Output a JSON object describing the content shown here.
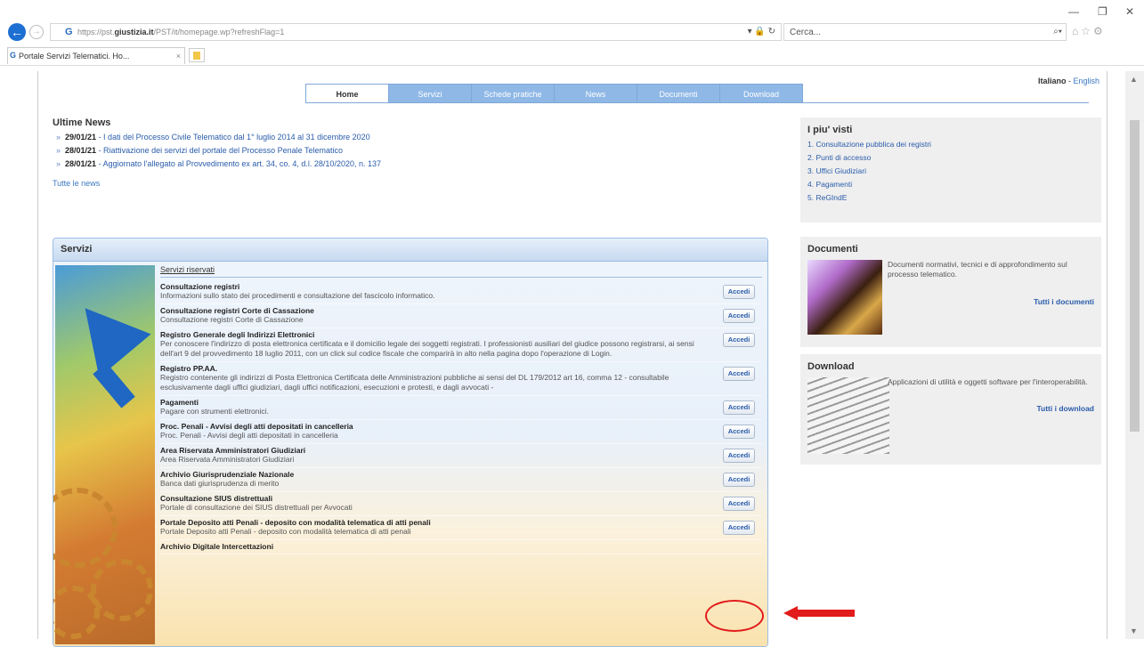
{
  "browser": {
    "url_prefix": "https://pst.",
    "url_domain": "giustizia.it",
    "url_path": "/PST/it/homepage.wp?refreshFlag=1",
    "address_controls": "▾ 🔒 ↻",
    "search_placeholder": "Cerca...",
    "search_icon": "⌕▾",
    "tab_title": "Portale Servizi Telematici. Ho...",
    "tab_close": "×",
    "back_icon": "←",
    "forward_icon": "→",
    "toolbar_icons": "⌂☆⚙",
    "minimize": "—",
    "maximize": "❐",
    "close": "✕",
    "scroll_up": "▲",
    "scroll_down": "▼"
  },
  "header": {
    "lang_current": "Italiano",
    "lang_sep": " - ",
    "lang_other": "English"
  },
  "nav": {
    "tabs": [
      "Home",
      "Servizi",
      "Schede pratiche",
      "News",
      "Documenti",
      "Download"
    ]
  },
  "news": {
    "title": "Ultime News",
    "items": [
      {
        "date": "29/01/21",
        "text": " - I dati del Processo Civile Telematico dal 1° luglio 2014 al 31 dicembre 2020"
      },
      {
        "date": "28/01/21",
        "text": " - Riattivazione dei servizi del portale del Processo Penale Telematico"
      },
      {
        "date": "28/01/21",
        "text": " - Aggiornato l'allegato al Provvedimento ex art. 34, co. 4, d.l. 28/10/2020, n. 137"
      }
    ],
    "all_link": "Tutte le news",
    "bullet": "»"
  },
  "servizi": {
    "title": "Servizi",
    "subtitle": "Servizi riservati",
    "button_label": "Accedi",
    "items": [
      {
        "name": "Consultazione registri",
        "desc": "Informazioni sullo stato dei procedimenti e consultazione del fascicolo informatico."
      },
      {
        "name": "Consultazione registri Corte di Cassazione",
        "desc": "Consultazione registri Corte di Cassazione"
      },
      {
        "name": "Registro Generale degli Indirizzi Elettronici",
        "desc": "Per conoscere l'indirizzo di posta elettronica certificata e il domicilio legale dei soggetti registrati. I professionisti ausiliari del giudice possono registrarsi, ai sensi dell'art 9 del provvedimento 18 luglio 2011, con un click sul codice fiscale che comparirà in alto nella pagina dopo l'operazione di Login."
      },
      {
        "name": "Registro PP.AA.",
        "desc": "Registro contenente gli indirizzi di Posta Elettronica Certificata delle Amministrazioni pubbliche ai sensi del DL 179/2012 art 16, comma 12 - consultabile esclusivamente dagli uffici giudiziari, dagli uffici notificazioni, esecuzioni e protesti, e dagli avvocati -"
      },
      {
        "name": "Pagamenti",
        "desc": "Pagare con strumenti elettronici."
      },
      {
        "name": "Proc. Penali - Avvisi degli atti depositati in cancelleria",
        "desc": "Proc. Penali - Avvisi degli atti depositati in cancelleria"
      },
      {
        "name": "Area Riservata Amministratori Giudiziari",
        "desc": "Area Riservata Amministratori Giudiziari"
      },
      {
        "name": "Archivio Giurisprudenziale Nazionale",
        "desc": "Banca dati giurisprudenza di merito"
      },
      {
        "name": "Consultazione SIUS distrettuali",
        "desc": "Portale di consultazione dei SIUS distrettuali per Avvocati"
      },
      {
        "name": "Portale Deposito atti Penali - deposito con modalità telematica di atti penali",
        "desc": "Portale Deposito atti Penali - deposito con modalità telematica di atti penali"
      },
      {
        "name": "Archivio Digitale Intercettazioni",
        "desc": ""
      }
    ]
  },
  "piu_visti": {
    "title": "I piu' visti",
    "items": [
      "1. Consultazione pubblica dei registri",
      "2. Punti di accesso",
      "3. Uffici Giudiziari",
      "4. Pagamenti",
      "5. ReGIndE"
    ]
  },
  "documenti": {
    "title": "Documenti",
    "text": "Documenti normativi, tecnici e di approfondimento sul processo telematico.",
    "link": "Tutti i documenti"
  },
  "download": {
    "title": "Download",
    "text": "Applicazioni di utilità e oggetti software per l'interoperabilità.",
    "link": "Tutti i download"
  },
  "colors": {
    "accent": "#8fb8e6",
    "link": "#2a5caa",
    "highlight": "#e21b1b"
  }
}
